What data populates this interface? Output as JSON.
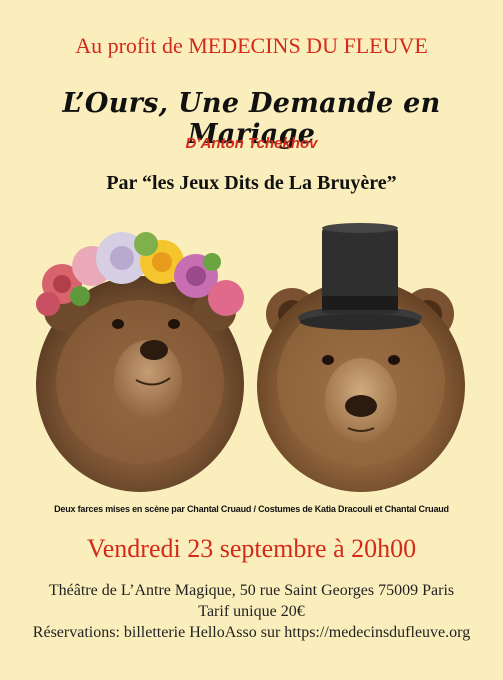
{
  "poster": {
    "benefit_line": "Au profit de MEDECINS DU FLEUVE",
    "title": "L’Ours, Une Demande en Mariage",
    "author": "D’Anton Tchekhov",
    "troupe": "Par “les Jeux Dits de La Bruyère”",
    "credits": "Deux farces mises en scène par Chantal Cruaud / Costumes de Katia Dracouli et Chantal Cruaud",
    "date_time": "Vendredi 23 septembre à 20h00",
    "venue": "Théâtre de L’Antre Magique, 50 rue Saint Georges 75009 Paris",
    "price": "Tarif unique 20€",
    "booking": "Réservations: billetterie HelloAsso  sur https://medecinsdufleuve.org"
  },
  "colors": {
    "background": "#fbeebd",
    "accent_red": "#d42a1a",
    "text_dark": "#111111"
  },
  "images": {
    "left": "bear-with-flower-crown",
    "right": "bear-with-top-hat"
  }
}
